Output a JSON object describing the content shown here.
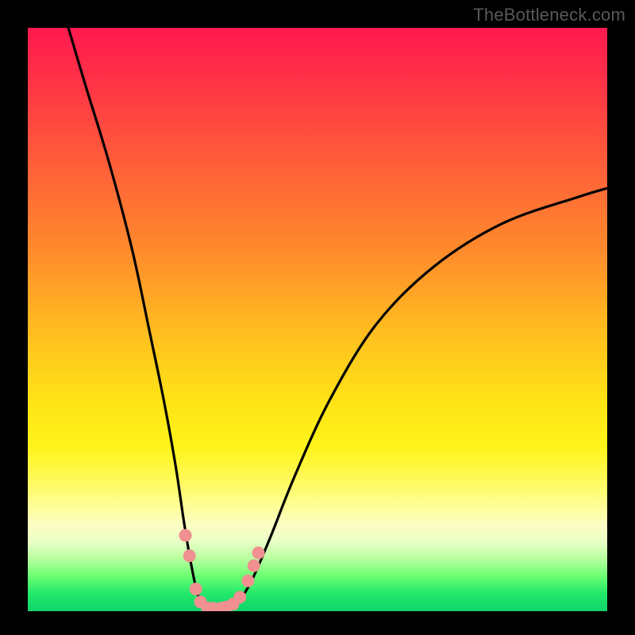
{
  "attribution": "TheBottleneck.com",
  "chart_data": {
    "type": "line",
    "title": "",
    "xlabel": "",
    "ylabel": "",
    "xlim": [
      0,
      100
    ],
    "ylim": [
      0,
      100
    ],
    "series": [
      {
        "name": "bottleneck-curve",
        "x": [
          7,
          10,
          14,
          18,
          21,
          23.5,
          25.5,
          27,
          28.2,
          29.3,
          30.5,
          32,
          33.5,
          35.2,
          37,
          39,
          42,
          46,
          52,
          60,
          70,
          82,
          95,
          100
        ],
        "y": [
          100,
          90,
          77,
          62,
          48,
          36,
          25,
          15,
          8,
          3,
          0.8,
          0.6,
          0.6,
          0.9,
          2.5,
          6,
          13,
          23,
          36,
          49,
          59,
          66.5,
          71,
          72.5
        ]
      }
    ],
    "markers": [
      {
        "name": "left-upper-1",
        "x": 27.2,
        "y": 13.0
      },
      {
        "name": "left-upper-2",
        "x": 27.9,
        "y": 9.5
      },
      {
        "name": "left-lower-1",
        "x": 29.0,
        "y": 3.8
      },
      {
        "name": "left-lower-2",
        "x": 29.8,
        "y": 1.6
      },
      {
        "name": "bottom-1",
        "x": 31.0,
        "y": 0.6
      },
      {
        "name": "bottom-2",
        "x": 32.0,
        "y": 0.5
      },
      {
        "name": "bottom-3",
        "x": 33.2,
        "y": 0.5
      },
      {
        "name": "bottom-4",
        "x": 34.2,
        "y": 0.7
      },
      {
        "name": "bottom-5",
        "x": 35.4,
        "y": 1.2
      },
      {
        "name": "right-lower-1",
        "x": 36.6,
        "y": 2.4
      },
      {
        "name": "right-upper-1",
        "x": 38.0,
        "y": 5.2
      },
      {
        "name": "right-upper-2",
        "x": 39.0,
        "y": 7.8
      },
      {
        "name": "right-upper-3",
        "x": 39.8,
        "y": 10.0
      }
    ],
    "marker_style": {
      "color": "#f09090",
      "radius_px": 8
    }
  }
}
